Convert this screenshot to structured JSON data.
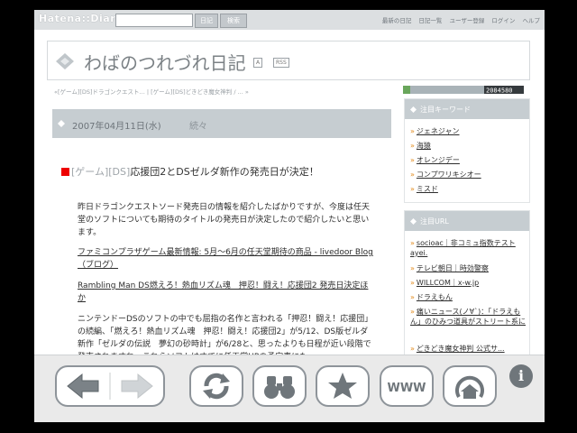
{
  "header": {
    "logo": "Hatena::Diary",
    "search_placeholder": "",
    "search_button": "日記",
    "search_button2": "検索",
    "nav": [
      "最新の日記",
      "日記一覧",
      "ユーザー登録",
      "ログイン",
      "ヘルプ"
    ]
  },
  "blog": {
    "title": "わばのつれづれ日記",
    "badge_a": "A",
    "badge_rss": "RSS"
  },
  "breadcrumb": "«[ゲーム][DS]ドラゴンクエスト...  |  [ゲーム][DS]どきどき魔女神判 / ... »",
  "entry": {
    "date": "2007年04月11日(水)",
    "date_tag": "続々",
    "title_cat1": "[ゲーム]",
    "title_cat2": "[DS]",
    "title_text": "応援団2とDSゼルダ新作の発売日が決定！",
    "para1": "昨日ドラゴンクエストソード発売日の情報を紹介したばかりですが、今度は任天堂のソフトについても期待のタイトルの発売日が決定したので紹介したいと思います。",
    "link1": "ファミコンプラザゲーム最新情報: 5月〜6月の任天堂期待の商品 - livedoor Blog（ブログ）",
    "link2": "Rambling Man DS燃えろ！熱血リズム魂　押忍！闘え！応援団2 発売日決定ほか",
    "para2": "ニンテンドーDSのソフトの中でも屈指の名作と言われる「押忍！闘え！応援団」の続編、「燃えろ！熱血リズム魂　押忍！闘え！応援団2」が5/12、DS版ゼルダ新作「ゼルダの伝説　夢幻の砂時計」が6/28と、思ったよりも日程が近い段階で発売されますね。これらソフトはすでに任天堂HPの予定表にも"
  },
  "sidebar": {
    "counter": "2084580",
    "keywords_title": "注目キーワード",
    "keywords": [
      "ジェネジャン",
      "海猿",
      "オレンジデー",
      "コンプワリキシオー",
      "ミスド"
    ],
    "url_title": "注目URL",
    "urls": [
      "socioac｜非コミュ指数テスト ayei.",
      "テレビ朝日｜時効警察",
      "WILLCOM｜x-w.jp",
      "ドラえもん",
      "痛いニュース(ノ∀`)：「ドラえもん」のひみつ道具がストリート系に",
      "どきどき魔女神判 公式サ..."
    ]
  },
  "toolbar": {
    "buttons": [
      "back",
      "forward",
      "reload",
      "search",
      "favorite",
      "www",
      "home"
    ],
    "www_label": "WWW",
    "info_label": "i"
  }
}
